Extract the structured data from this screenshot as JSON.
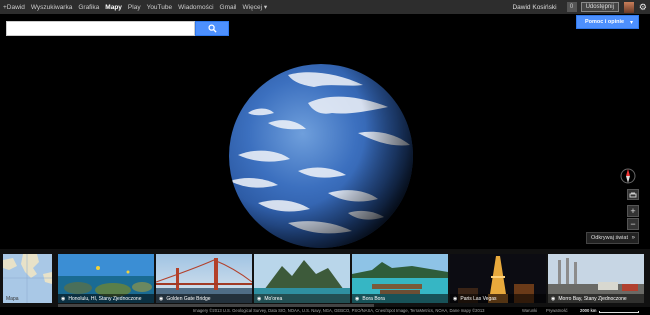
{
  "gbar": {
    "items": [
      {
        "label": "+Dawid",
        "active": false
      },
      {
        "label": "Wyszukiwarka",
        "active": false
      },
      {
        "label": "Grafika",
        "active": false
      },
      {
        "label": "Mapy",
        "active": true
      },
      {
        "label": "Play",
        "active": false
      },
      {
        "label": "YouTube",
        "active": false
      },
      {
        "label": "Wiadomości",
        "active": false
      },
      {
        "label": "Gmail",
        "active": false
      },
      {
        "label": "Więcej ▾",
        "active": false
      }
    ],
    "username": "Dawid Kosiński",
    "notifications": "0",
    "share_label": "Udostępnij",
    "gear_icon": "gear-icon"
  },
  "search": {
    "placeholder": "",
    "value": "",
    "button_icon": "search-icon"
  },
  "help": {
    "label": "Pomoc i opinie",
    "chevron": "▾"
  },
  "controls": {
    "compass_icon": "compass-icon",
    "tilt_icon": "tilt-icon",
    "zoom_in": "+",
    "zoom_out": "−",
    "explore_label": "Odkrywaj świat",
    "explore_chevron": "»"
  },
  "carousel": {
    "items": [
      {
        "label": "Mapa",
        "type": "map"
      },
      {
        "label": "Honolulu, HI, Stany Zjednoczone",
        "type": "photo"
      },
      {
        "label": "Golden Gate Bridge",
        "type": "photo"
      },
      {
        "label": "Mo'orea",
        "type": "photo"
      },
      {
        "label": "Bora Bora",
        "type": "photo"
      },
      {
        "label": "Paris Las Vegas",
        "type": "photo"
      },
      {
        "label": "Morro Bay, Stany Zjednoczone",
        "type": "photo"
      }
    ]
  },
  "footer": {
    "attribution": "Imagery ©2013 U.S. Geological Survey, Data SIO, NOAA, U.S. Navy, NGA, GEBCO, PSO/NASA, Cnes/Spot Image, TerraMetrics, NOAA, Dane mapy ©2013",
    "terms": "Warunki",
    "privacy": "Prywatność",
    "scale": "2000 km"
  },
  "colors": {
    "accent": "#4d90fe",
    "topbar": "#2d2d2d",
    "background": "#000000"
  }
}
